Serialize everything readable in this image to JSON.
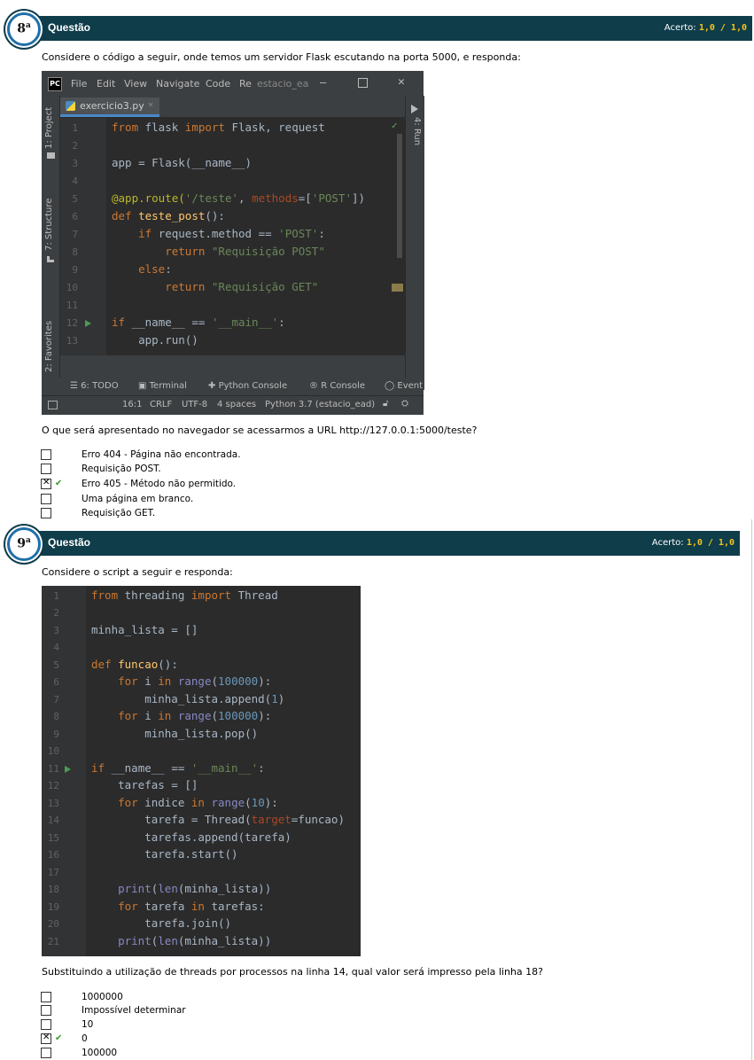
{
  "q8": {
    "number": "8",
    "suffix": "a",
    "title": "Questão",
    "acerto_label": "Acerto:",
    "acerto_value": "1,0  /  1,0",
    "prompt": "Considere o código a seguir, onde temos um servidor Flask escutando na porta 5000, e responda:",
    "question": "O que será apresentado no navegador se acessarmos a URL http://127.0.0.1:5000/teste?",
    "options": [
      {
        "label": "Erro 404 - Página não encontrada.",
        "checked": false
      },
      {
        "label": "Requisição POST.",
        "checked": false
      },
      {
        "label": "Erro 405 - Método não permitido.",
        "checked": true
      },
      {
        "label": "Uma página em branco.",
        "checked": false
      },
      {
        "label": "Requisição GET.",
        "checked": false
      }
    ],
    "ide": {
      "logo": "PC",
      "menu": [
        "File",
        "Edit",
        "View",
        "Navigate",
        "Code",
        "Re",
        "estacio_ea"
      ],
      "tab": "exercicio3.py",
      "side_left": [
        "1: Project",
        "7: Structure",
        "2: Favorites"
      ],
      "side_right": "4: Run",
      "bottom_tools": [
        "6: TODO",
        "Terminal",
        "Python Console",
        "R Console",
        "Event"
      ],
      "status": [
        "16:1",
        "CRLF",
        "UTF-8",
        "4 spaces",
        "Python 3.7 (estacio_ead)"
      ],
      "line_numbers": [
        "1",
        "2",
        "3",
        "4",
        "5",
        "6",
        "7",
        "8",
        "9",
        "10",
        "11",
        "12",
        "13"
      ]
    }
  },
  "q9": {
    "number": "9",
    "suffix": "a",
    "title": "Questão",
    "acerto_label": "Acerto:",
    "acerto_value": "1,0  /  1,0",
    "prompt": "Considere o script a seguir e responda:",
    "question": "Substituindo a utilização de threads por processos na linha 14, qual valor será impresso pela linha 18?",
    "options": [
      {
        "label": "1000000",
        "checked": false
      },
      {
        "label": "Impossível determinar",
        "checked": false
      },
      {
        "label": "10",
        "checked": false
      },
      {
        "label": "0",
        "checked": true
      },
      {
        "label": "100000",
        "checked": false
      }
    ],
    "line_numbers": [
      "1",
      "2",
      "3",
      "4",
      "5",
      "6",
      "7",
      "8",
      "9",
      "10",
      "11",
      "12",
      "13",
      "14",
      "15",
      "16",
      "17",
      "18",
      "19",
      "20",
      "21"
    ]
  },
  "colors": {
    "header_bg": "#0f3d4a",
    "acerto": "#f5c518",
    "check": "#3a9a2a",
    "ide_bg": "#2b2b2b"
  }
}
